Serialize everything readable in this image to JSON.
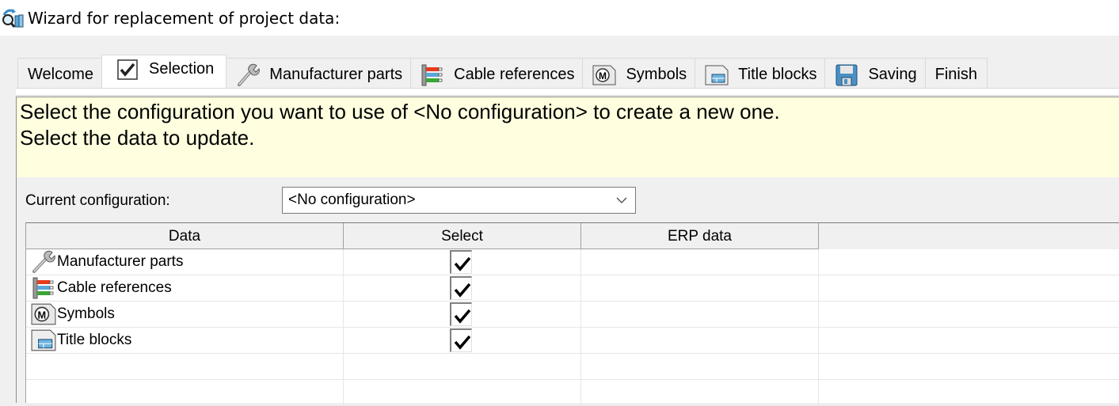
{
  "window": {
    "title": "Wizard for replacement of project data:",
    "icon": "wizard-replace-icon"
  },
  "tabs": [
    {
      "label": "Welcome",
      "icon": null,
      "active": false
    },
    {
      "label": "Selection",
      "icon": "checkbox-icon",
      "active": true
    },
    {
      "label": "Manufacturer parts",
      "icon": "wrench-icon",
      "active": false
    },
    {
      "label": "Cable references",
      "icon": "cable-icon",
      "active": false
    },
    {
      "label": "Symbols",
      "icon": "symbol-icon",
      "active": false
    },
    {
      "label": "Title blocks",
      "icon": "title-block-icon",
      "active": false
    },
    {
      "label": "Saving",
      "icon": "floppy-disk-icon",
      "active": false
    },
    {
      "label": "Finish",
      "icon": null,
      "active": false
    }
  ],
  "info": {
    "line1": "Select the configuration you want to use of <No configuration> to create a new one.",
    "line2": "Select the data to update.",
    "background": "#ffffdf"
  },
  "config": {
    "label": "Current configuration:",
    "selected": "<No configuration>"
  },
  "grid": {
    "columns": [
      "Data",
      "Select",
      "ERP data"
    ],
    "rows": [
      {
        "data": "Manufacturer parts",
        "icon": "wrench-icon",
        "select": true,
        "erp": ""
      },
      {
        "data": "Cable references",
        "icon": "cable-icon",
        "select": true,
        "erp": ""
      },
      {
        "data": "Symbols",
        "icon": "symbol-icon",
        "select": true,
        "erp": ""
      },
      {
        "data": "Title blocks",
        "icon": "title-block-icon",
        "select": true,
        "erp": ""
      }
    ],
    "empty_rows": 2
  }
}
